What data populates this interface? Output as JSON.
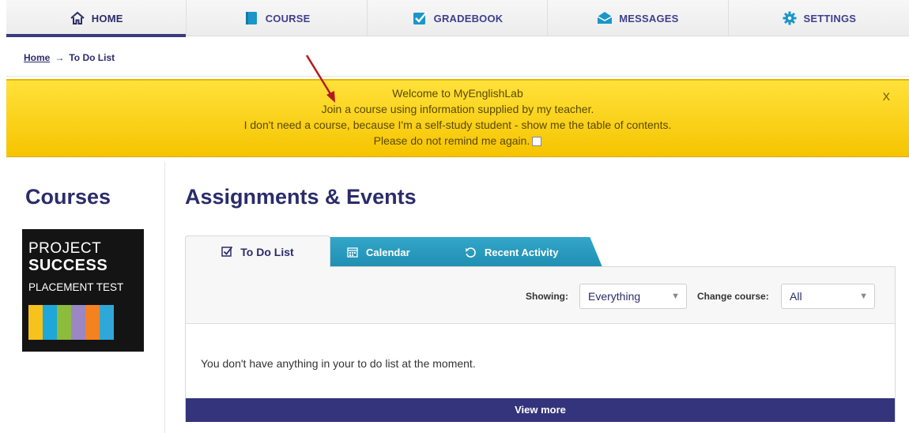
{
  "nav": {
    "items": [
      {
        "label": "HOME",
        "icon": "home-icon",
        "active": true
      },
      {
        "label": "COURSE",
        "icon": "book-icon"
      },
      {
        "label": "GRADEBOOK",
        "icon": "check-icon"
      },
      {
        "label": "MESSAGES",
        "icon": "envelope-icon"
      },
      {
        "label": "SETTINGS",
        "icon": "gear-icon"
      }
    ]
  },
  "breadcrumb": {
    "home": "Home",
    "separator": "→",
    "current": "To Do List"
  },
  "banner": {
    "line1": "Welcome to MyEnglishLab",
    "line2": "Join a course using information supplied by my teacher.",
    "line3": "I don't need a course, because I'm a self-study student - show me the table of contents.",
    "line4": "Please do not remind me again.",
    "close": "X"
  },
  "sidebar": {
    "title": "Courses",
    "course": {
      "line1": "PROJECT",
      "line2": "SUCCESS",
      "line3": "PLACEMENT TEST",
      "bar_colors": [
        "#f7c21c",
        "#1ea7d8",
        "#8dbb3c",
        "#9a87c4",
        "#f58220",
        "#2fa8d9"
      ]
    }
  },
  "main": {
    "title": "Assignments & Events",
    "tabs": [
      {
        "label": "To Do List",
        "icon": "checkbox-icon",
        "active": true
      },
      {
        "label": "Calendar",
        "icon": "calendar-icon"
      },
      {
        "label": "Recent Activity",
        "icon": "history-icon"
      }
    ],
    "filters": {
      "showing_label": "Showing:",
      "showing_value": "Everything",
      "course_label": "Change course:",
      "course_value": "All"
    },
    "empty_message": "You don't have anything in your to do list at the moment.",
    "view_more": "View more"
  },
  "colors": {
    "brand": "#2b2c6a",
    "banner": "#ffd21a",
    "tab": "#2598bd",
    "view_more": "#34347c"
  }
}
